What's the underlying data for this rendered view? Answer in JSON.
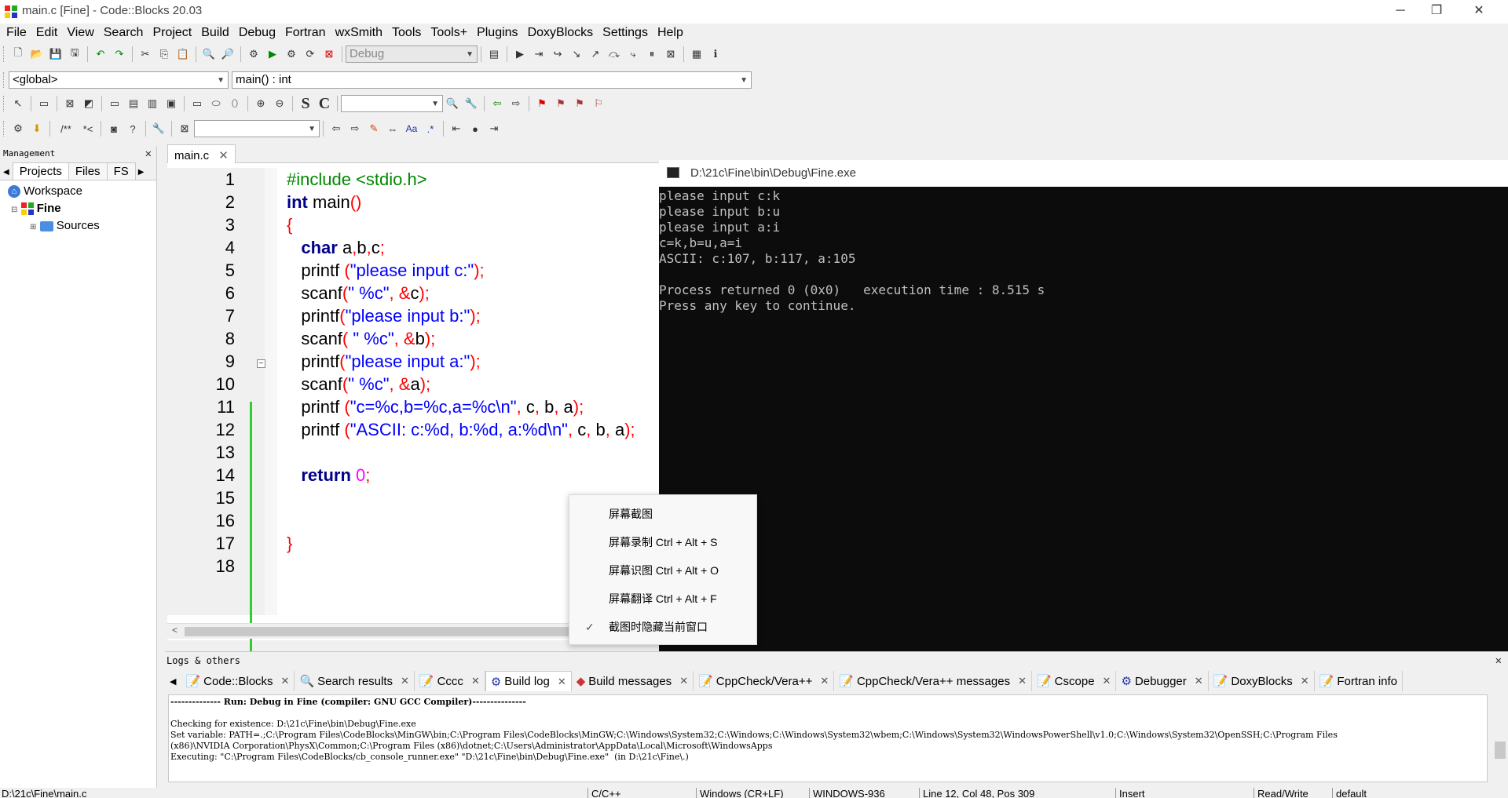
{
  "window": {
    "title": "main.c [Fine] - Code::Blocks 20.03",
    "minimize": "─",
    "restore": "❐",
    "close": "✕"
  },
  "menu": [
    "File",
    "Edit",
    "View",
    "Search",
    "Project",
    "Build",
    "Debug",
    "Fortran",
    "wxSmith",
    "Tools",
    "Tools+",
    "Plugins",
    "DoxyBlocks",
    "Settings",
    "Help"
  ],
  "toolbar": {
    "build_target": "Debug",
    "scope_combo": "<global>",
    "function_combo": "main() : int"
  },
  "management": {
    "title": "Management",
    "tabs": [
      "Projects",
      "Files",
      "FS"
    ],
    "tree": {
      "workspace": "Workspace",
      "project": "Fine",
      "folder": "Sources"
    }
  },
  "editor": {
    "tab": "main.c",
    "line_numbers": [
      "1",
      "2",
      "3",
      "4",
      "5",
      "6",
      "7",
      "8",
      "9",
      "10",
      "11",
      "12",
      "13",
      "14",
      "15",
      "16",
      "17",
      "18"
    ]
  },
  "console": {
    "title": "D:\\21c\\Fine\\bin\\Debug\\Fine.exe",
    "lines": [
      "please input c:k",
      "please input b:u",
      "please input a:i",
      "c=k,b=u,a=i",
      "ASCII: c:107, b:117, a:105",
      "",
      "Process returned 0 (0x0)   execution time : 8.515 s",
      "Press any key to continue."
    ]
  },
  "context_menu": {
    "items": [
      {
        "label": "屏幕截图",
        "shortcut": "",
        "checked": false
      },
      {
        "label": "屏幕录制",
        "shortcut": "Ctrl + Alt + S",
        "checked": false
      },
      {
        "label": "屏幕识图",
        "shortcut": "Ctrl + Alt + O",
        "checked": false
      },
      {
        "label": "屏幕翻译",
        "shortcut": "Ctrl + Alt + F",
        "checked": false
      },
      {
        "label": "截图时隐藏当前窗口",
        "shortcut": "",
        "checked": true
      }
    ]
  },
  "logs": {
    "title": "Logs & others",
    "tabs": [
      "Code::Blocks",
      "Search results",
      "Cccc",
      "Build log",
      "Build messages",
      "CppCheck/Vera++",
      "CppCheck/Vera++ messages",
      "Cscope",
      "Debugger",
      "DoxyBlocks",
      "Fortran info"
    ],
    "active_tab": "Build log",
    "lines": [
      "-------------- Run: Debug in Fine (compiler: GNU GCC Compiler)---------------",
      "",
      "Checking for existence: D:\\21c\\Fine\\bin\\Debug\\Fine.exe",
      "Set variable: PATH=.;C:\\Program Files\\CodeBlocks\\MinGW\\bin;C:\\Program Files\\CodeBlocks\\MinGW;C:\\Windows\\System32;C:\\Windows;C:\\Windows\\System32\\wbem;C:\\Windows\\System32\\WindowsPowerShell\\v1.0;C:\\Windows\\System32\\OpenSSH;C:\\Program Files",
      "(x86)\\NVIDIA Corporation\\PhysX\\Common;C:\\Program Files (x86)\\dotnet;C:\\Users\\Administrator\\AppData\\Local\\Microsoft\\WindowsApps",
      "Executing: \"C:\\Program Files\\CodeBlocks/cb_console_runner.exe\" \"D:\\21c\\Fine\\bin\\Debug\\Fine.exe\"  (in D:\\21c\\Fine\\.)"
    ]
  },
  "status": {
    "file": "D:\\21c\\Fine\\main.c",
    "lang": "C/C++",
    "eol": "Windows (CR+LF)",
    "encoding": "WINDOWS-936",
    "position": "Line 12, Col 48, Pos 309",
    "mode": "Insert",
    "access": "Read/Write",
    "profile": "default"
  }
}
